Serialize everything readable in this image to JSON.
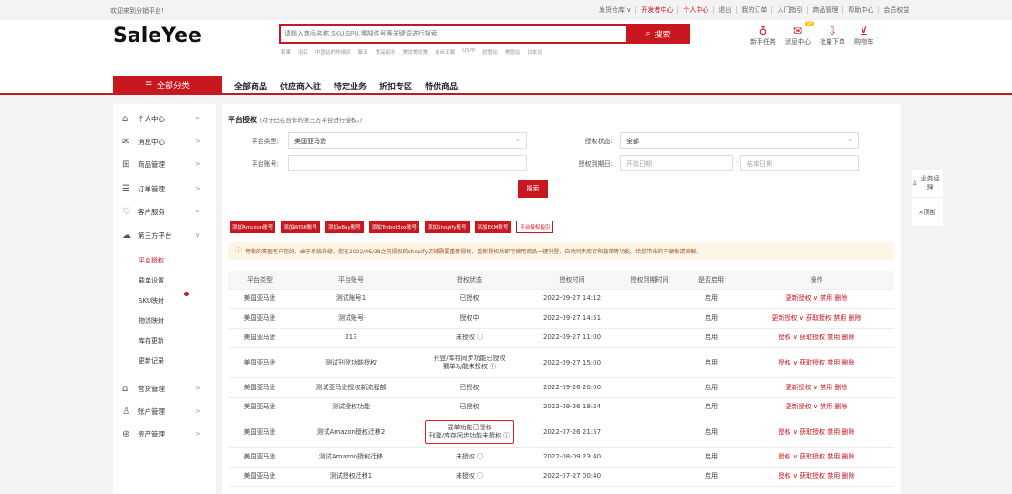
{
  "topbar": {
    "welcome": "欢迎来到分销平台!",
    "links": [
      "发货仓库 ∨",
      "开发者中心",
      "个人中心",
      "退出",
      "我的订单",
      "入门指引",
      "商品管理",
      "帮助中心",
      "会员权益"
    ]
  },
  "brand": {
    "logo": "SaleYee"
  },
  "search": {
    "placeholder": "请输入商品名称,SKU,SPU,零部件号等关键词进行搜索",
    "button": "搜索"
  },
  "hot_terms": [
    "鞋果",
    "浴缸",
    "中国站的热搜词",
    "聚五",
    "食品用水",
    "美纹美纹美",
    "金丝五属",
    "USPP",
    "欧盟站",
    "美国站",
    "日本站"
  ],
  "header_icons": [
    {
      "icon": "task-icon",
      "glyph": "♁",
      "label": "新手任务"
    },
    {
      "icon": "message-icon",
      "glyph": "✉",
      "label": "消息中心",
      "badge": "99"
    },
    {
      "icon": "download-icon",
      "glyph": "⇩",
      "label": "批量下单"
    },
    {
      "icon": "cart-icon",
      "glyph": "⊻",
      "label": "购物车"
    }
  ],
  "nav": {
    "all": "全部分类",
    "items": [
      "全部商品",
      "供应商入驻",
      "特定业务",
      "折扣专区",
      "特供商品"
    ]
  },
  "sidebar": {
    "items": [
      {
        "label": "个人中心",
        "icon": "user-icon",
        "glyph": "⌂"
      },
      {
        "label": "消息中心",
        "icon": "message-icon",
        "glyph": "✉"
      },
      {
        "label": "商品管理",
        "icon": "goods-icon",
        "glyph": "⊞"
      },
      {
        "label": "订单管理",
        "icon": "order-icon",
        "glyph": "☰"
      },
      {
        "label": "客户服务",
        "icon": "heart-icon",
        "glyph": "♡"
      },
      {
        "label": "第三方平台",
        "icon": "cloud-icon",
        "glyph": "☁"
      }
    ],
    "subitems": [
      "平台授权",
      "载单设置",
      "SKU映射",
      "物流映射",
      "库存更新",
      "更新记录"
    ],
    "items2": [
      {
        "label": "营货管理",
        "icon": "warehouse-icon",
        "glyph": "⌂"
      },
      {
        "label": "账户管理",
        "icon": "account-icon",
        "glyph": "♙"
      },
      {
        "label": "资产管理",
        "icon": "asset-icon",
        "glyph": "⊛"
      }
    ]
  },
  "page": {
    "title": "平台授权",
    "subtitle": "(对于已在合作的第三方平台进行授权。)",
    "filters": {
      "platform_type_label": "平台类型:",
      "platform_type_value": "美国亚马逊",
      "auth_status_label": "授权状态:",
      "auth_status_value": "全部",
      "account_label": "平台账号:",
      "expire_label": "授权到期日:",
      "start_placeholder": "开始日期",
      "end_placeholder": "结束日期",
      "search_button": "搜索"
    },
    "add_buttons": [
      "添加Amazon账号",
      "添加WISH账号",
      "添加eBay账号",
      "添加TrobotBox账号",
      "添加Shopify账号",
      "添加EKM账号"
    ],
    "guide_button": "平台授权指引",
    "notice": "尊敬的赛盈客户您好，由于系统升级，您在2022/06/28之前授权的shopify店铺需要重新授权，重新授权后即可使用商品一键刊登、自动同步库存和载单等功能。给您带来的不便敬请谅解。"
  },
  "table": {
    "headers": [
      "平台类型",
      "平台账号",
      "授权状态",
      "授权时间",
      "授权到期时间",
      "是否启用",
      "操作"
    ],
    "rows": [
      {
        "type": "美国亚马逊",
        "account": "测试账号1",
        "status": "已授权",
        "time": "2022-09-27 14:12",
        "expire": "",
        "enabled": "启用",
        "ops": "更新授权 ∨  禁用 删除"
      },
      {
        "type": "美国亚马逊",
        "account": "测试账号",
        "status": "授权中",
        "time": "2022-09-27 14:51",
        "expire": "",
        "enabled": "启用",
        "ops": "更新授权 ∨  获取授权 禁用 删除"
      },
      {
        "type": "美国亚马逊",
        "account": "213",
        "status": "未授权 ⓘ",
        "time": "2022-09-27 11:00",
        "expire": "",
        "enabled": "启用",
        "ops": "授权 ∨  获取授权 禁用 删除"
      },
      {
        "type": "美国亚马逊",
        "account": "测试刊登功能授权",
        "status": "刊登/库存同步功能已授权",
        "status2": "载单功能未授权 ⓘ",
        "time": "2022-09-27 15:00",
        "expire": "",
        "enabled": "启用",
        "ops": "授权 ∨  获取授权 禁用 删除"
      },
      {
        "type": "美国亚马逊",
        "account": "测试亚马逊授权新流程部",
        "status": "已授权",
        "time": "2022-09-26 20:00",
        "expire": "",
        "enabled": "启用",
        "ops": "更新授权 ∨  禁用 删除"
      },
      {
        "type": "美国亚马逊",
        "account": "测试授权功能",
        "status": "已授权",
        "time": "2022-09-26 19:24",
        "expire": "",
        "enabled": "启用",
        "ops": "更新授权 ∨  禁用 删除"
      },
      {
        "type": "美国亚马逊",
        "account": "测试Amazon授权迁移2",
        "status": "载单功能已授权",
        "status2": "刊登/库存同步功能未授权 ⓘ",
        "time": "2022-07-26 21:57",
        "expire": "",
        "enabled": "启用",
        "ops": "授权 ∨  获取授权 禁用 删除"
      },
      {
        "type": "美国亚马逊",
        "account": "测试Amazon授权迁移",
        "status": "未授权 ⓘ",
        "time": "2022-08-09 23:40",
        "expire": "",
        "enabled": "启用",
        "ops": "授权 ∨  获取授权 禁用 删除"
      },
      {
        "type": "美国亚马逊",
        "account": "测试授权迁移1",
        "status": "未授权 ⓘ",
        "time": "2022-07-27 00:40",
        "expire": "",
        "enabled": "启用",
        "ops": "授权 ∨  获取授权 禁用 删除"
      }
    ]
  },
  "float": {
    "manager": "业务经理",
    "top": "顶部"
  },
  "colors": {
    "accent": "#c9171f",
    "notice_bg": "#fdf6e6"
  }
}
